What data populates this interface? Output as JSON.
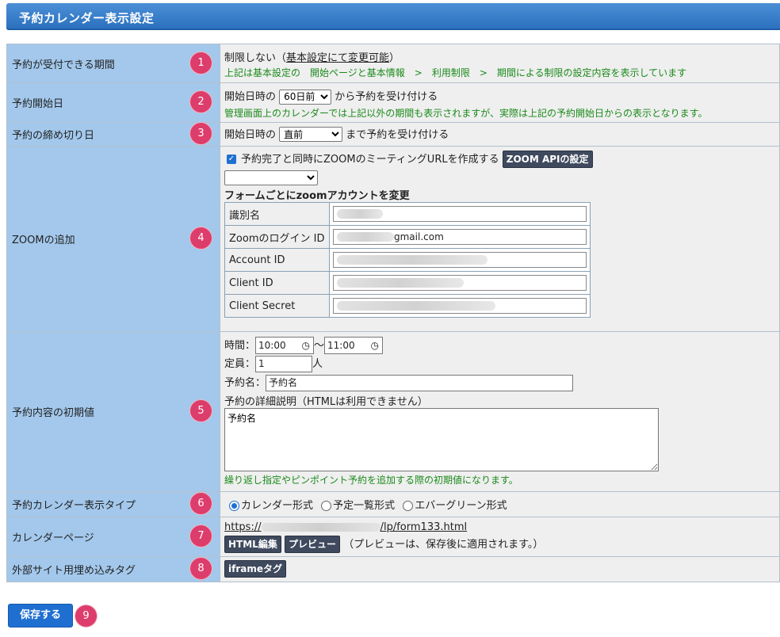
{
  "header": {
    "title": "予約カレンダー表示設定"
  },
  "rows": {
    "period": {
      "label": "予約が受付できる期間",
      "num": "1",
      "text_main": "制限しない（",
      "text_link": "基本設定にて変更可能",
      "text_end": "）",
      "note": "上記は基本設定の　開始ページと基本情報　>　利用制限　>　期間による制限の設定内容を表示しています"
    },
    "start": {
      "label": "予約開始日",
      "num": "2",
      "prefix": "開始日時の",
      "select": "60日前",
      "suffix": "から予約を受け付ける",
      "note": "管理画面上のカレンダーでは上記以外の期間も表示されますが、実際は上記の予約開始日からの表示となります。"
    },
    "deadline": {
      "label": "予約の締め切り日",
      "num": "3",
      "prefix": "開始日時の",
      "select": "直前",
      "suffix": "まで予約を受け付ける"
    },
    "zoom": {
      "label": "ZOOMの追加",
      "num": "4",
      "checkbox_label": "予約完了と同時にZOOMのミーティングURLを作成する",
      "api_button": "ZOOM APIの設定",
      "account_heading": "フォームごとにzoomアカウントを変更",
      "fields": [
        {
          "label": "識別名",
          "value": ""
        },
        {
          "label": "Zoomのログイン ID",
          "value": "gmail.com"
        },
        {
          "label": "Account ID",
          "value": ""
        },
        {
          "label": "Client ID",
          "value": ""
        },
        {
          "label": "Client Secret",
          "value": ""
        }
      ]
    },
    "defaults": {
      "label": "予約内容の初期値",
      "num": "5",
      "time_label": "時間：",
      "time_start": "10:00",
      "time_sep": "〜",
      "time_end": "11:00",
      "capacity_label": "定員：",
      "capacity_value": "1",
      "capacity_unit": "人",
      "name_label": "予約名：",
      "name_value": "予約名",
      "desc_label": "予約の詳細説明（HTMLは利用できません）",
      "desc_value": "予約名",
      "note": "繰り返し指定やピンポイント予約を追加する際の初期値になります。"
    },
    "display_type": {
      "label": "予約カレンダー表示タイプ",
      "num": "6",
      "options": [
        "カレンダー形式",
        "予定一覧形式",
        "エバーグリーン形式"
      ],
      "selected": "カレンダー形式"
    },
    "calendar_page": {
      "label": "カレンダーページ",
      "num": "7",
      "url_prefix": "https://",
      "url_suffix": "/lp/form133.html",
      "html_edit_button": "HTML編集",
      "preview_button": "プレビュー",
      "note": "（プレビューは、保存後に適用されます。）"
    },
    "embed": {
      "label": "外部サイト用埋め込みタグ",
      "num": "8",
      "iframe_button": "iframeタグ"
    }
  },
  "footer": {
    "save_button": "保存する",
    "num": "9"
  },
  "colors": {
    "accent": "#1f6fd1",
    "label_bg": "#a3c8ec",
    "badge": "#dd3d6a",
    "note_green": "#1a8a1a"
  },
  "icons": {
    "clock": "clock-icon",
    "checkbox": "checkmark-icon",
    "select": "chevron-down-icon"
  }
}
